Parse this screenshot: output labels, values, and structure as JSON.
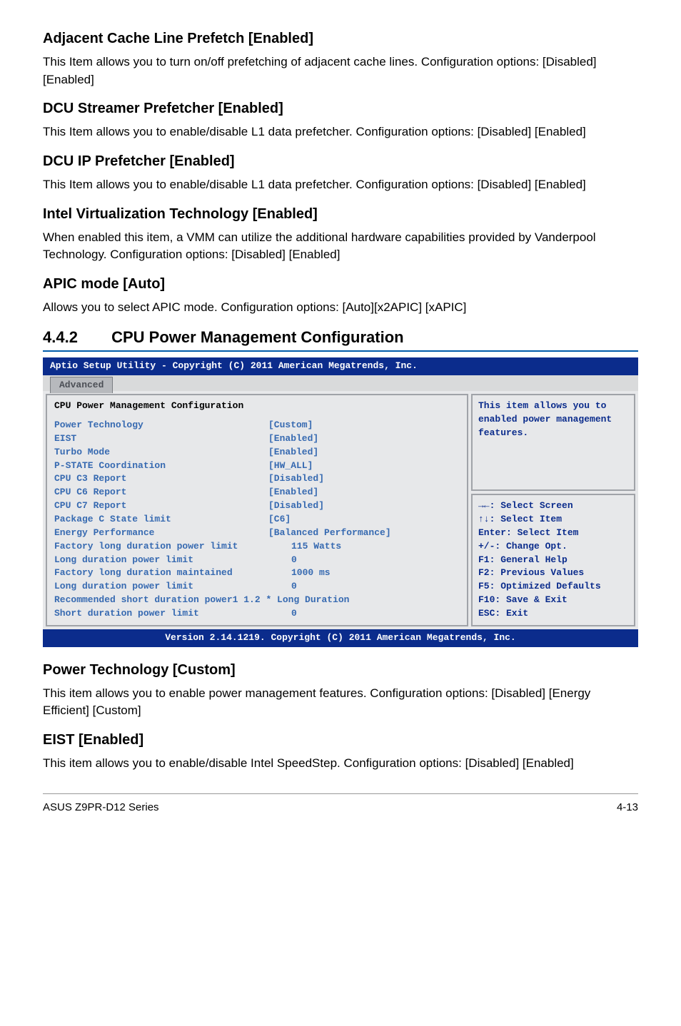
{
  "sections": {
    "adj_cache": {
      "title": "Adjacent Cache Line Prefetch [Enabled]",
      "p": "This Item allows you to turn on/off prefetching of adjacent cache lines. Configuration options: [Disabled] [Enabled]"
    },
    "dcu_streamer": {
      "title": "DCU Streamer Prefetcher [Enabled]",
      "p": "This Item allows you to enable/disable L1 data prefetcher. Configuration options: [Disabled] [Enabled]"
    },
    "dcu_ip": {
      "title": "DCU IP Prefetcher [Enabled]",
      "p": "This Item allows you to enable/disable L1 data prefetcher. Configuration options: [Disabled] [Enabled]"
    },
    "intel_vt": {
      "title": "Intel Virtualization Technology [Enabled]",
      "p": "When enabled this item, a VMM can utilize the additional hardware capabilities provided by Vanderpool Technology. Configuration options: [Disabled] [Enabled]"
    },
    "apic": {
      "title": "APIC mode [Auto]",
      "p": "Allows you to select APIC mode. Configuration options: [Auto][x2APIC] [xAPIC]"
    },
    "main_heading": {
      "no": "4.4.2",
      "title": "CPU Power Management Configuration"
    },
    "power_tech": {
      "title": "Power Technology [Custom]",
      "p": "This item allows you to enable power management features. Configuration options: [Disabled] [Energy Efficient] [Custom]"
    },
    "eist": {
      "title": "EIST [Enabled]",
      "p": "This item allows you to enable/disable Intel SpeedStep. Configuration options: [Disabled] [Enabled]"
    }
  },
  "bios": {
    "top": "Aptio Setup Utility - Copyright (C) 2011 American Megatrends, Inc.",
    "tab": "Advanced",
    "panel_title": "CPU Power Management Configuration",
    "rows": [
      {
        "label": "Power Technology",
        "value": "[Custom]"
      },
      {
        "label": "EIST",
        "value": "[Enabled]"
      },
      {
        "label": "Turbo Mode",
        "value": "[Enabled]"
      },
      {
        "label": "P-STATE Coordination",
        "value": "[HW_ALL]"
      },
      {
        "label": "CPU C3 Report",
        "value": "[Disabled]"
      },
      {
        "label": "CPU C6 Report",
        "value": "[Enabled]"
      },
      {
        "label": "CPU C7 Report",
        "value": "[Disabled]"
      },
      {
        "label": "Package C State limit",
        "value": "[C6]"
      },
      {
        "label": "Energy Performance",
        "value": "[Balanced Performance]"
      },
      {
        "label": "Factory long duration power limit",
        "value": "115 Watts",
        "indent": true
      },
      {
        "label": "Long duration power limit",
        "value": "0",
        "indent": true
      },
      {
        "label": "Factory long duration maintained",
        "value": "1000 ms",
        "indent": true
      },
      {
        "label": "Long duration power limit",
        "value": "0",
        "indent": true
      },
      {
        "label": "Recommended short duration power1 1.2 * Long Duration",
        "value": "",
        "wide": true
      },
      {
        "label": "Short duration power limit",
        "value": "0",
        "indent": true
      }
    ],
    "help": "This item allows you to enabled power management features.",
    "keys": [
      "→←: Select Screen",
      "↑↓:  Select Item",
      "Enter: Select Item",
      "+/-: Change Opt.",
      "F1: General Help",
      "F2: Previous Values",
      "F5: Optimized Defaults",
      "F10: Save & Exit",
      "ESC: Exit"
    ],
    "footer": "Version 2.14.1219. Copyright (C) 2011 American Megatrends, Inc."
  },
  "page_footer": {
    "left": "ASUS Z9PR-D12 Series",
    "right": "4-13"
  }
}
